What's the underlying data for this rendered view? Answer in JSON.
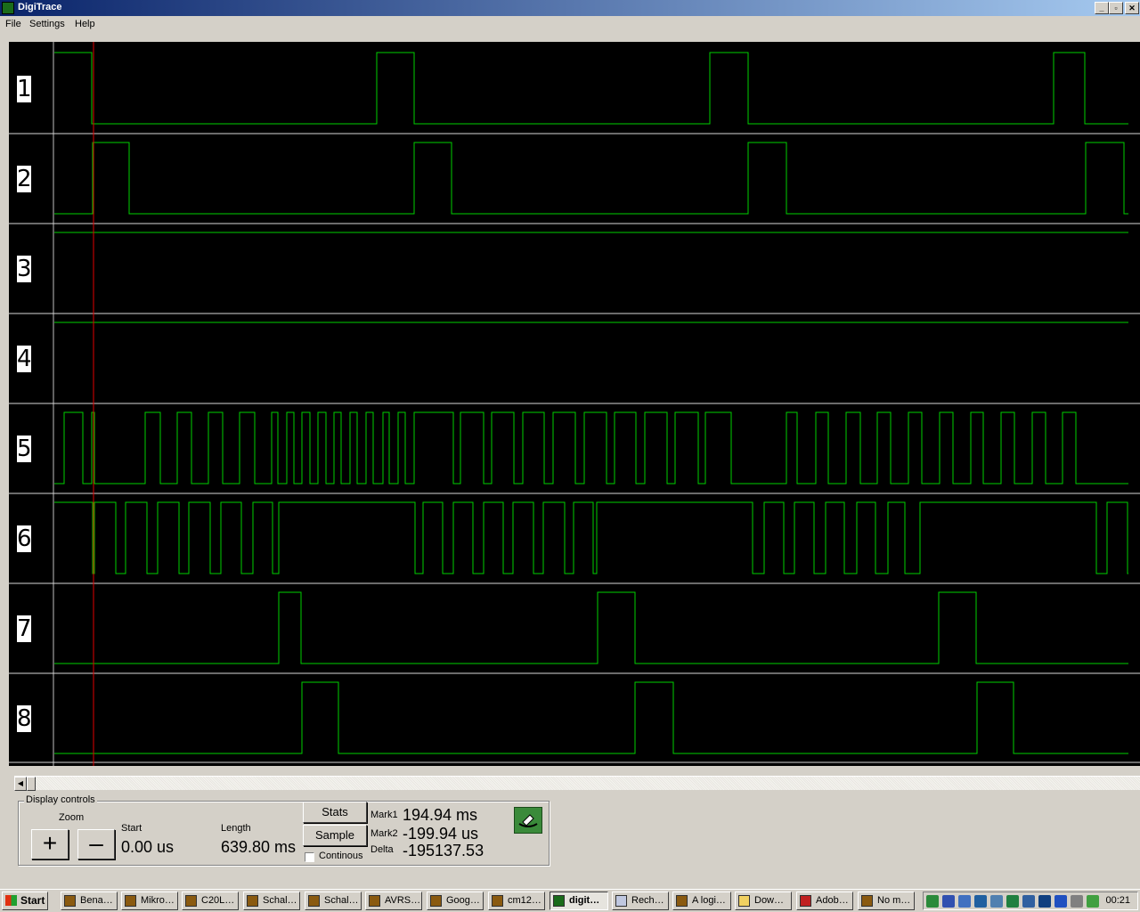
{
  "window": {
    "title": "DigiTrace"
  },
  "menu": [
    "File",
    "Settings",
    "Help"
  ],
  "channels": [
    {
      "label": "1",
      "initial": 1,
      "transitions": [
        103,
        423,
        465,
        797,
        840,
        1183,
        1218
      ]
    },
    {
      "label": "2",
      "initial": 0,
      "transitions": [
        104,
        145,
        465,
        507,
        840,
        883,
        1219,
        1262
      ]
    },
    {
      "label": "3",
      "initial": 1,
      "transitions": []
    },
    {
      "label": "4",
      "initial": 1,
      "transitions": []
    },
    {
      "label": "5",
      "initial": 0,
      "transitions": [
        72,
        93,
        103,
        106,
        163,
        180,
        199,
        215,
        234,
        250,
        269,
        286,
        305,
        312,
        322,
        330,
        339,
        348,
        357,
        366,
        375,
        383,
        393,
        401,
        411,
        419,
        430,
        437,
        447,
        455,
        465,
        509,
        517,
        543,
        552,
        577,
        587,
        611,
        621,
        646,
        656,
        681,
        690,
        714,
        724,
        749,
        758,
        784,
        792,
        821,
        883,
        895,
        916,
        930,
        950,
        966,
        985,
        1000,
        1020,
        1035,
        1055,
        1070,
        1090,
        1104,
        1124,
        1139,
        1159,
        1174,
        1193,
        1208
      ]
    },
    {
      "label": "6",
      "initial": 1,
      "transitions": [
        104,
        106,
        130,
        141,
        165,
        177,
        201,
        212,
        236,
        248,
        271,
        284,
        306,
        313,
        466,
        475,
        497,
        509,
        531,
        543,
        565,
        576,
        599,
        610,
        634,
        644,
        666,
        670,
        845,
        858,
        880,
        892,
        914,
        927,
        948,
        962,
        983,
        997,
        1016,
        1033,
        1231,
        1243,
        1266
      ]
    },
    {
      "label": "7",
      "initial": 0,
      "transitions": [
        313,
        338,
        671,
        713,
        1054,
        1096
      ]
    },
    {
      "label": "8",
      "initial": 0,
      "transitions": [
        339,
        380,
        713,
        756,
        1097,
        1138
      ]
    }
  ],
  "marker_color": "#e00000",
  "trace_color": "#00d000",
  "controls": {
    "group_title": "Display controls",
    "zoom_label": "Zoom",
    "zoom_in": "+",
    "zoom_out": "–",
    "start_label": "Start",
    "start_value": "0.00 us",
    "length_label": "Length",
    "length_value": "639.80 ms",
    "stats_button": "Stats",
    "sample_button": "Sample",
    "continuous_label": "Continous",
    "mark1_label": "Mark1",
    "mark1_value": "194.94 ms",
    "mark2_label": "Mark2",
    "mark2_value": "-199.94 us",
    "delta_label": "Delta",
    "delta_value": "-195137.53"
  },
  "taskbar": {
    "start": "Start",
    "tasks": [
      "Bena…",
      "Mikro…",
      "C20L…",
      "Schal…",
      "Schal…",
      "AVRS…",
      "Goog…",
      "cm12…",
      "digit…",
      "Rech…",
      "A logi…",
      "Dow…",
      "Adob…",
      "No m…"
    ],
    "clock": "00:21"
  }
}
